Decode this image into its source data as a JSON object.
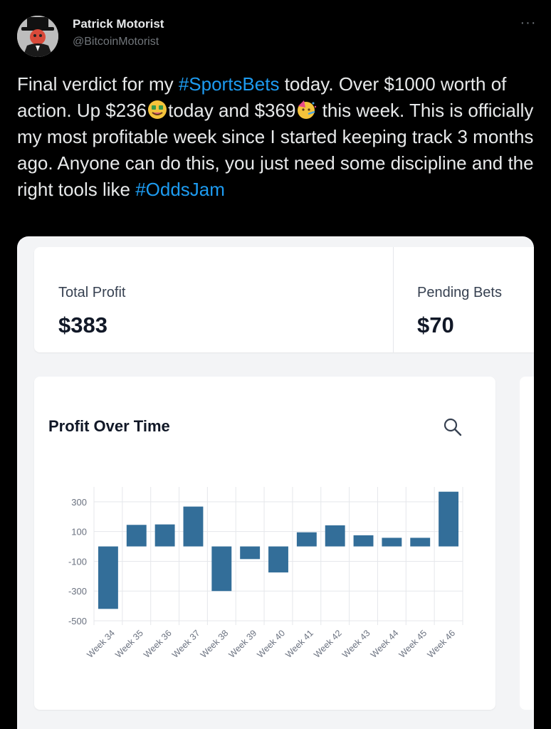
{
  "tweet": {
    "author_name": "Patrick Motorist",
    "author_handle": "@BitcoinMotorist",
    "more_label": "···",
    "text_1": "Final verdict for my ",
    "hashtag_1": "#SportsBets",
    "text_2": " today. Over $1000 worth of action. Up $236",
    "text_3": "today and $369",
    "text_4": " this week. This is officially my most profitable week since I started keeping track 3 months ago. Anyone can do this, you just need some discipline and the right tools like ",
    "hashtag_2": "#OddsJam",
    "emoji_1": "money-mouth-face",
    "emoji_2": "partying-face"
  },
  "stats": {
    "total_profit_label": "Total Profit",
    "total_profit_value": "$383",
    "pending_bets_label": "Pending Bets",
    "pending_bets_value": "$70"
  },
  "chart_panel": {
    "title": "Profit Over Time",
    "icon": "search-icon"
  },
  "colors": {
    "background": "#000000",
    "hashtag": "#1d9bf0",
    "bar": "#336e99",
    "card": "#ffffff",
    "media_bg": "#f3f4f6"
  },
  "chart_data": {
    "type": "bar",
    "categories": [
      "Week 34",
      "Week 35",
      "Week 36",
      "Week 37",
      "Week 38",
      "Week 39",
      "Week 40",
      "Week 41",
      "Week 42",
      "Week 43",
      "Week 44",
      "Week 45",
      "Week 46"
    ],
    "values": [
      -420,
      145,
      148,
      268,
      -300,
      -85,
      -175,
      95,
      142,
      75,
      58,
      58,
      368
    ],
    "yticks": [
      300,
      100,
      -100,
      -300,
      -500
    ],
    "ylim": [
      -500,
      400
    ],
    "grid": true,
    "xlabel": "",
    "ylabel": ""
  }
}
